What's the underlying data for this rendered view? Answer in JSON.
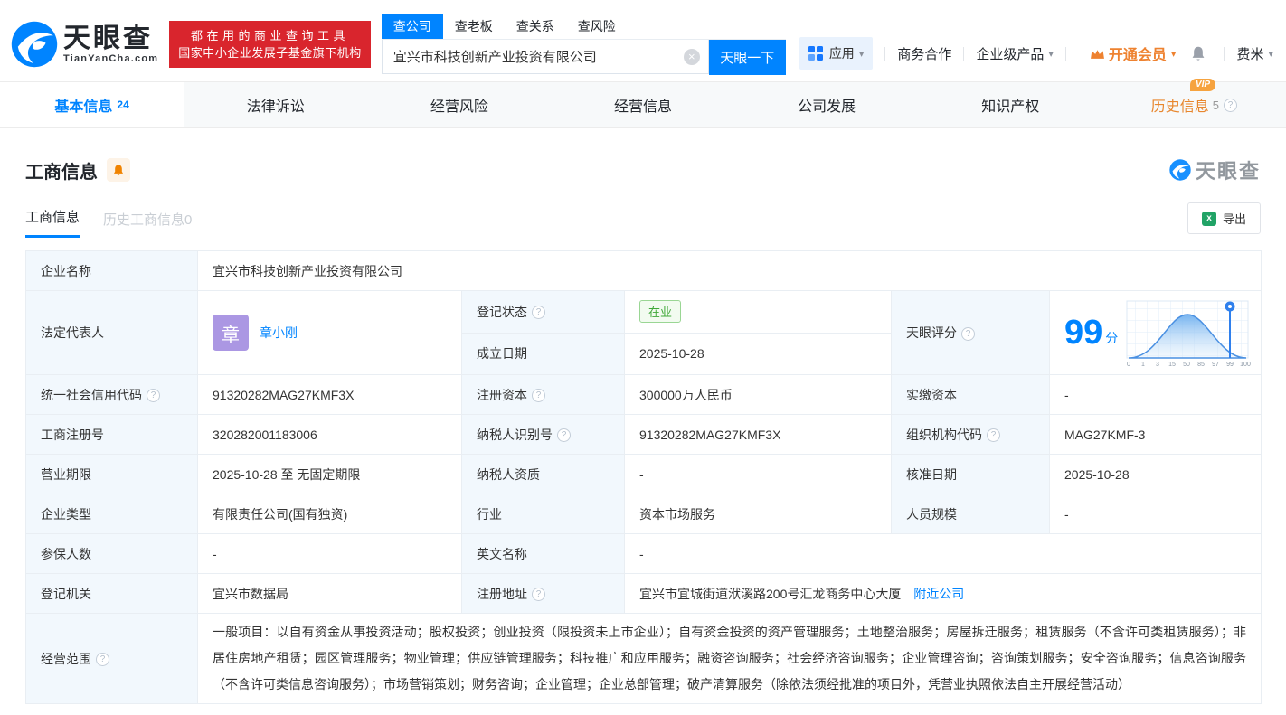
{
  "header": {
    "brand": "天眼查",
    "brand_domain": "TianYanCha.com",
    "slogan_line1": "都在用的商业查询工具",
    "slogan_line2": "国家中小企业发展子基金旗下机构",
    "search_tabs": [
      {
        "label": "查公司"
      },
      {
        "label": "查老板"
      },
      {
        "label": "查关系"
      },
      {
        "label": "查风险"
      }
    ],
    "search_value": "宜兴市科技创新产业投资有限公司",
    "search_button": "天眼一下",
    "nav": {
      "apps": "应用",
      "cooperation": "商务合作",
      "enterprise_products": "企业级产品",
      "vip": "开通会员",
      "username": "费米"
    }
  },
  "tabs": [
    {
      "label": "基本信息",
      "count": "24"
    },
    {
      "label": "法律诉讼"
    },
    {
      "label": "经营风险"
    },
    {
      "label": "经营信息"
    },
    {
      "label": "公司发展"
    },
    {
      "label": "知识产权"
    },
    {
      "label": "历史信息",
      "count": "5",
      "vip_label": "VIP"
    }
  ],
  "section": {
    "title": "工商信息",
    "watermark": "天眼查",
    "subtab_active": "工商信息",
    "subtab_history": "历史工商信息0",
    "export_label": "导出"
  },
  "table": {
    "company_name": {
      "label": "企业名称",
      "value": "宜兴市科技创新产业投资有限公司"
    },
    "legal_rep": {
      "label": "法定代表人",
      "avatar_char": "章",
      "name": "章小刚"
    },
    "reg_status": {
      "label": "登记状态",
      "value": "在业"
    },
    "establish_date": {
      "label": "成立日期",
      "value": "2025-10-28"
    },
    "tyc_score": {
      "label": "天眼评分",
      "score": "99",
      "unit": "分"
    },
    "credit_code": {
      "label": "统一社会信用代码",
      "value": "91320282MAG27KMF3X"
    },
    "reg_capital": {
      "label": "注册资本",
      "value": "300000万人民币"
    },
    "paid_capital": {
      "label": "实缴资本",
      "value": "-"
    },
    "reg_number": {
      "label": "工商注册号",
      "value": "320282001183006"
    },
    "taxpayer_id": {
      "label": "纳税人识别号",
      "value": "91320282MAG27KMF3X"
    },
    "org_code": {
      "label": "组织机构代码",
      "value": "MAG27KMF-3"
    },
    "business_term": {
      "label": "营业期限",
      "value": "2025-10-28 至 无固定期限"
    },
    "taxpayer_quality": {
      "label": "纳税人资质",
      "value": "-"
    },
    "approval_date": {
      "label": "核准日期",
      "value": "2025-10-28"
    },
    "company_type": {
      "label": "企业类型",
      "value": "有限责任公司(国有独资)"
    },
    "industry": {
      "label": "行业",
      "value": "资本市场服务"
    },
    "staff_size": {
      "label": "人员规模",
      "value": "-"
    },
    "insured_count": {
      "label": "参保人数",
      "value": "-"
    },
    "english_name": {
      "label": "英文名称",
      "value": "-"
    },
    "reg_authority": {
      "label": "登记机关",
      "value": "宜兴市数据局"
    },
    "reg_address": {
      "label": "注册地址",
      "value": "宜兴市宜城街道洑溪路200号汇龙商务中心大厦",
      "nearby_link": "附近公司"
    },
    "business_scope": {
      "label": "经营范围",
      "value": "一般项目：以自有资金从事投资活动；股权投资；创业投资（限投资未上市企业）；自有资金投资的资产管理服务；土地整治服务；房屋拆迁服务；租赁服务（不含许可类租赁服务）；非居住房地产租赁；园区管理服务；物业管理；供应链管理服务；科技推广和应用服务；融资咨询服务；社会经济咨询服务；企业管理咨询；咨询策划服务；安全咨询服务；信息咨询服务（不含许可类信息咨询服务）；市场营销策划；财务咨询；企业管理；企业总部管理；破产清算服务（除依法须经批准的项目外，凭营业执照依法自主开展经营活动）"
    }
  },
  "score_chart": {
    "type": "area",
    "x_labels": [
      "0",
      "1",
      "3",
      "15",
      "50",
      "85",
      "97",
      "99",
      "100"
    ],
    "marker_value": "99"
  }
}
